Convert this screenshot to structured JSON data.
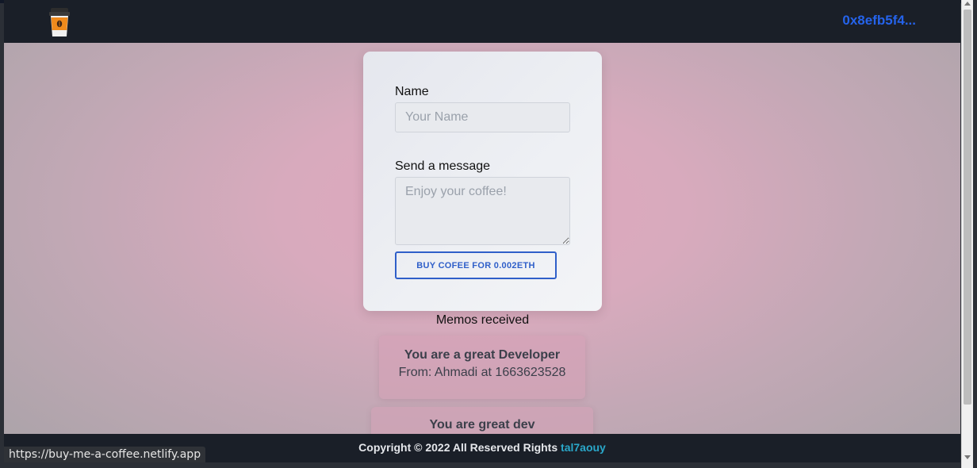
{
  "navbar": {
    "logo_icon": "coffee-cup-icon",
    "wallet_address": "0x8efb5f4..."
  },
  "form": {
    "name_label": "Name",
    "name_placeholder": "Your Name",
    "name_value": "",
    "message_label": "Send a message",
    "message_placeholder": "Enjoy your coffee!",
    "message_value": "",
    "buy_button_label": "BUY COFEE FOR 0.002ETH"
  },
  "memos": {
    "title": "Memos received",
    "items": [
      {
        "message": "You are a great Developer",
        "from": "From: Ahmadi at 1663623528"
      },
      {
        "message": "You are great dev"
      }
    ]
  },
  "footer": {
    "copyright": "Copyright © 2022 All Reserved Rights",
    "author_link": "tal7aouy"
  },
  "status_bar": {
    "url": "https://buy-me-a-coffee.netlify.app"
  },
  "colors": {
    "accent": "#2563eb",
    "button_border": "#2f5fc9",
    "navbar_bg": "#1a1f28",
    "footer_link": "#2aa7c9"
  }
}
